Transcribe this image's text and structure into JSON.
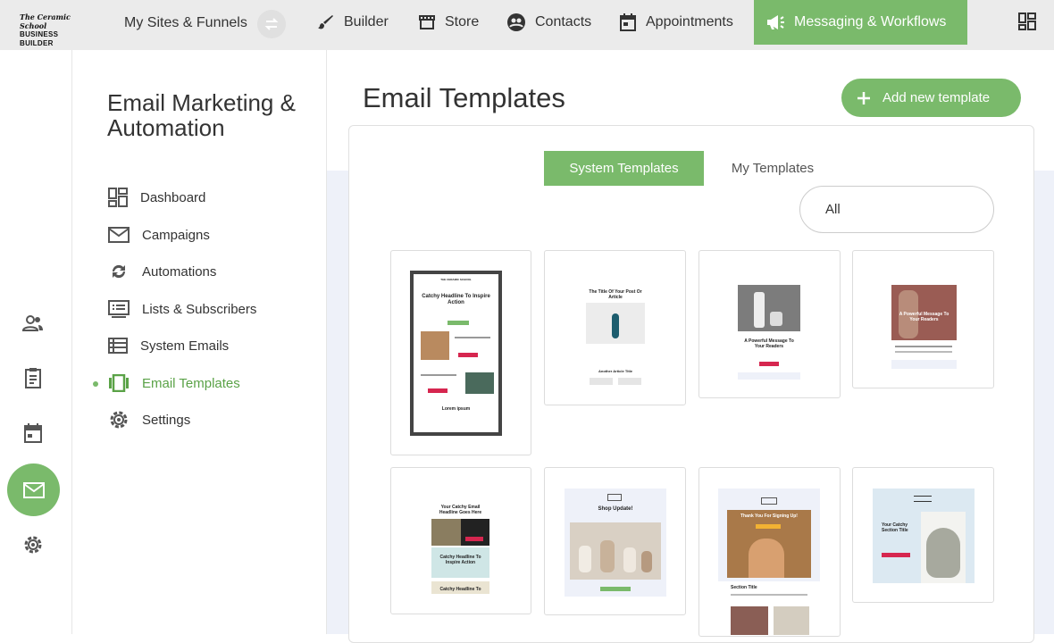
{
  "topbar": {
    "logo_line1": "The Ceramic School",
    "logo_line2": "BUSINESS BUILDER",
    "sites_label": "My Sites & Funnels",
    "nav": [
      {
        "label": "Builder",
        "icon": "brush-icon"
      },
      {
        "label": "Store",
        "icon": "store-icon"
      },
      {
        "label": "Contacts",
        "icon": "contacts-icon"
      },
      {
        "label": "Appointments",
        "icon": "calendar-icon"
      },
      {
        "label": "Messaging & Workflows",
        "icon": "megaphone-icon"
      }
    ]
  },
  "sidebar": {
    "title": "Email Marketing & Automation",
    "items": [
      {
        "label": "Dashboard",
        "icon": "dashboard-icon"
      },
      {
        "label": "Campaigns",
        "icon": "mail-icon"
      },
      {
        "label": "Automations",
        "icon": "refresh-icon"
      },
      {
        "label": "Lists & Subscribers",
        "icon": "list-icon"
      },
      {
        "label": "System Emails",
        "icon": "table-icon"
      },
      {
        "label": "Email Templates",
        "icon": "carousel-icon",
        "active": true
      },
      {
        "label": "Settings",
        "icon": "gear-icon"
      }
    ]
  },
  "main": {
    "title": "Email Templates",
    "add_button": "Add new template",
    "tabs": [
      "System Templates",
      "My Templates"
    ],
    "filter_value": "All"
  },
  "templates": {
    "t1": {
      "brand": "THE CERAMIC SCHOOL",
      "headline": "Catchy Headline To Inspire Action",
      "footer": "Lorem ipsum"
    },
    "t2": {
      "headline": "The Title Of Your Post Or Article",
      "subhead": "Another Article Title"
    },
    "t3": {
      "headline": "A Powerful Message To Your Readers"
    },
    "t4": {
      "headline": "A Powerful Message To Your Readers"
    },
    "t5": {
      "headline": "Your Catchy Email Headline Goes Here",
      "headline2": "Catchy Headline To Inspire Action",
      "headline3": "Catchy Headline To"
    },
    "t6": {
      "headline": "Shop Update!"
    },
    "t7": {
      "headline": "Thank You For Signing Up!",
      "section": "Section Title"
    },
    "t8": {
      "headline": "Your Catchy Section Title"
    }
  },
  "colors": {
    "accent": "#7aba6b",
    "page_bg": "#eef1f9",
    "topbar": "#ebebeb",
    "cta": "#d6264f"
  }
}
